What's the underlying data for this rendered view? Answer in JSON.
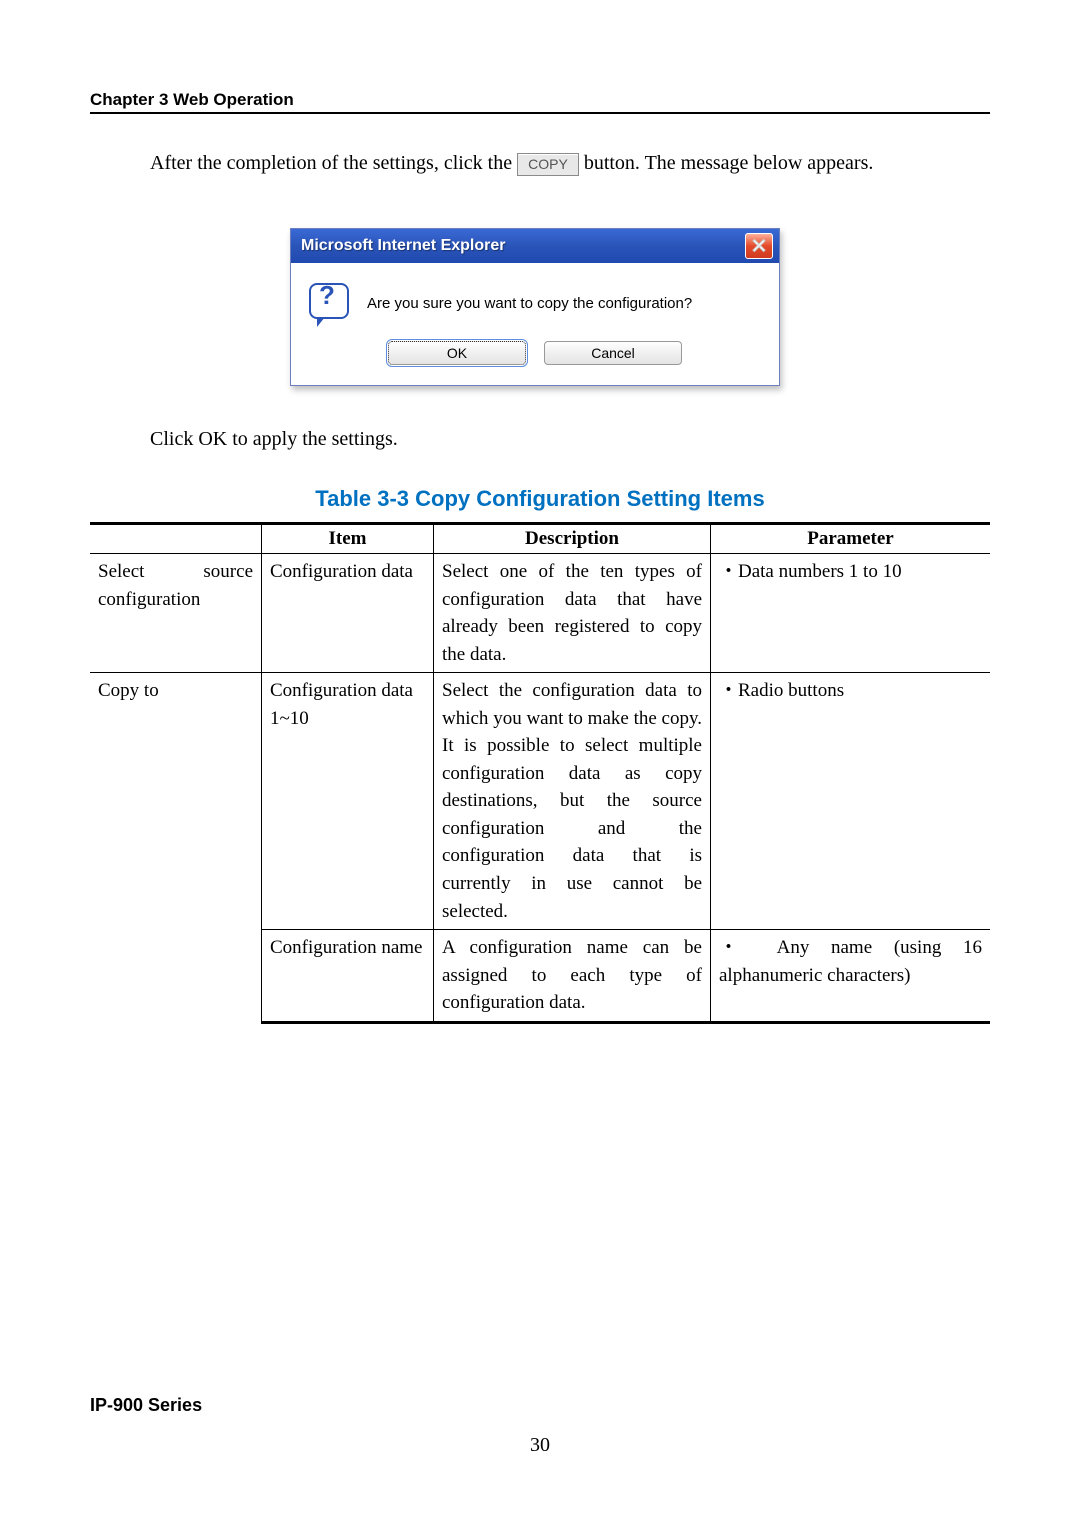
{
  "chapter_heading": "Chapter 3  Web Operation",
  "intro_before": "After the completion of the settings, click the ",
  "copy_button_label": "COPY",
  "intro_after": " button. The message below appears.",
  "dialog": {
    "title": "Microsoft Internet Explorer",
    "message": "Are you sure you want to copy the configuration?",
    "ok": "OK",
    "cancel": "Cancel"
  },
  "click_ok_line": "Click OK to apply the settings.",
  "table_title": "Table 3-3 Copy Configuration Setting Items",
  "headers": {
    "blank": "",
    "item": "Item",
    "description": "Description",
    "parameter": "Parameter"
  },
  "rows": {
    "r1": {
      "group": "Select source configuration",
      "item": "Configuration data",
      "desc": "  Select one of the ten types of configuration data that have already been registered to copy the data.",
      "param": "・Data numbers 1 to 10"
    },
    "r2": {
      "group": "Copy to",
      "item": "Configuration data 1~10",
      "desc": "  Select the configuration data to which you want to make the copy. It is possible to select multiple configuration data as copy destinations, but the source configuration and the configuration data that is currently in use cannot be selected.",
      "param": "・Radio buttons"
    },
    "r3": {
      "item": "Configuration name",
      "desc": "  A configuration name can be assigned to each type of configuration data.",
      "param": "・ Any name (using 16 alphanumeric characters)"
    }
  },
  "series": "IP-900 Series",
  "page_number": "30"
}
